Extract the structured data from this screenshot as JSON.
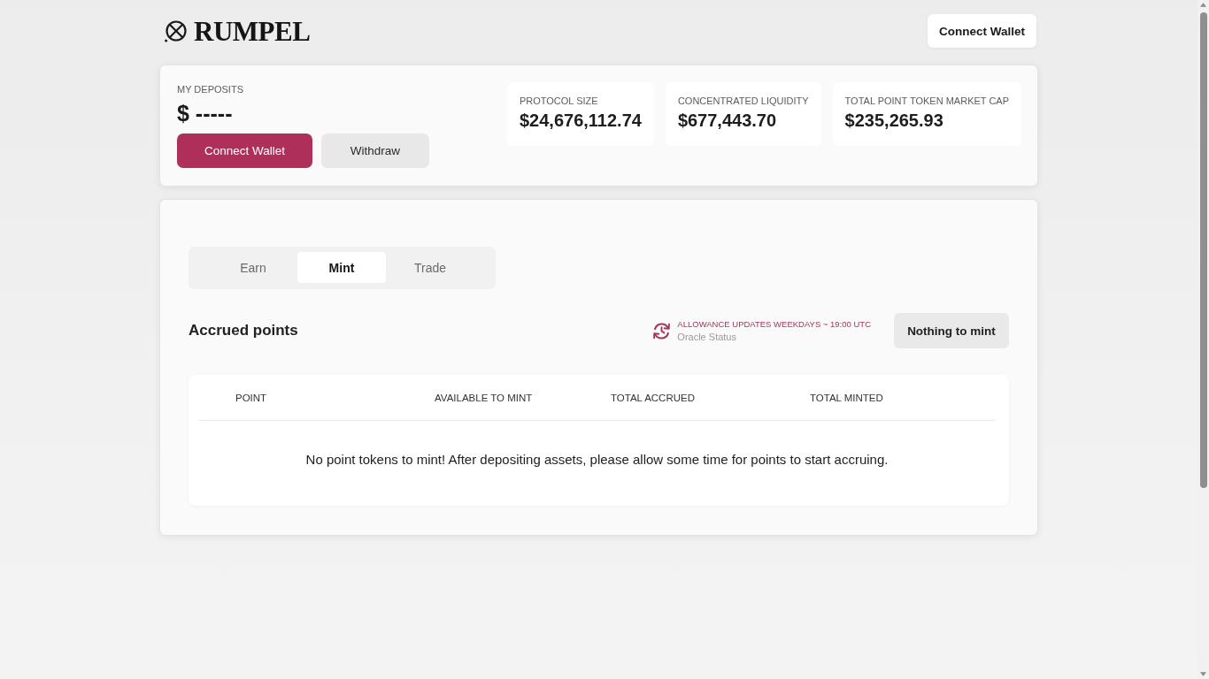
{
  "header": {
    "logo": "RUMPEL",
    "connect_button": "Connect Wallet"
  },
  "deposits": {
    "label": "MY DEPOSITS",
    "value": "$ -----",
    "buttons": [
      {
        "label": "Connect Wallet",
        "kind": "primary"
      },
      {
        "label": "Withdraw",
        "kind": "secondary"
      }
    ]
  },
  "stats": [
    {
      "label": "PROTOCOL SIZE",
      "value": "$24,676,112.74"
    },
    {
      "label": "CONCENTRATED LIQUIDITY",
      "value": "$677,443.70"
    },
    {
      "label": "TOTAL POINT TOKEN MARKET CAP",
      "value": "$235,265.93"
    }
  ],
  "tabs": [
    {
      "label": "Earn",
      "selected": false
    },
    {
      "label": "Mint",
      "selected": true
    },
    {
      "label": "Trade",
      "selected": false
    }
  ],
  "section": {
    "title": "Accrued points",
    "oracle": {
      "notice": "ALLOWANCE UPDATES WEEKDAYS ~ 19:00 UTC",
      "label": "Oracle Status"
    },
    "action_button": "Nothing to mint"
  },
  "table": {
    "columns": [
      "POINT",
      "AVAILABLE TO MINT",
      "TOTAL ACCRUED",
      "TOTAL MINTED"
    ],
    "empty_message": "No point tokens to mint! After depositing assets, please allow some time for points to start accruing."
  }
}
